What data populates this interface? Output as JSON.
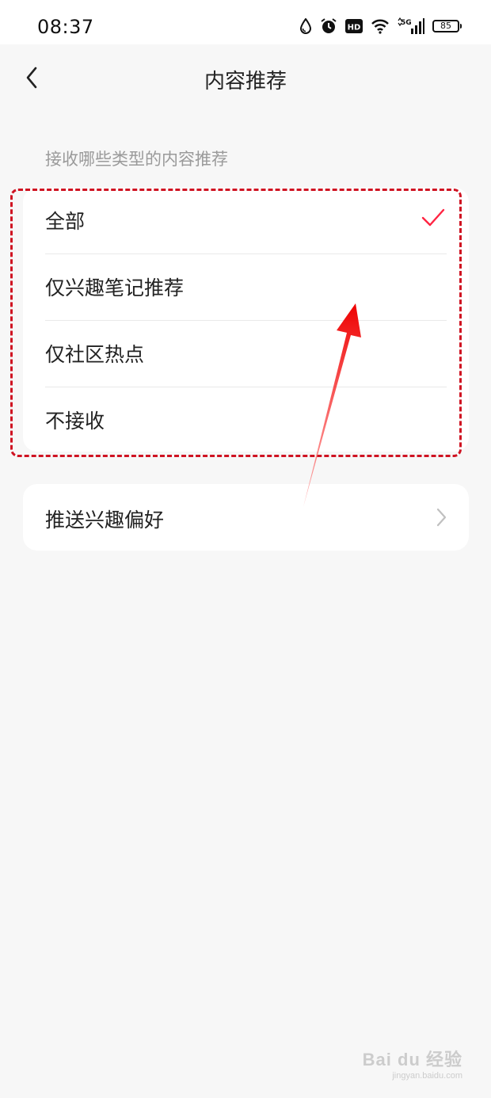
{
  "status_bar": {
    "time": "08:37",
    "icons": [
      "water-drop-icon",
      "alarm-icon",
      "hd-icon",
      "wifi-icon",
      "5g-signal-icon",
      "battery-icon"
    ],
    "hd_label": "HD",
    "network_label": "5G",
    "battery": "85"
  },
  "nav": {
    "title": "内容推荐",
    "back_icon": "chevron-left-icon"
  },
  "section": {
    "label": "接收哪些类型的内容推荐"
  },
  "options": [
    {
      "label": "全部",
      "selected": true
    },
    {
      "label": "仅兴趣笔记推荐",
      "selected": false
    },
    {
      "label": "仅社区热点",
      "selected": false
    },
    {
      "label": "不接收",
      "selected": false
    }
  ],
  "preference": {
    "label": "推送兴趣偏好",
    "icon": "chevron-right-icon"
  },
  "colors": {
    "accent": "#ff2442",
    "annotation": "#cf1322",
    "background": "#f7f7f7",
    "card": "#ffffff"
  },
  "watermark": {
    "main": "Bai du 经验",
    "sub": "jingyan.baidu.com"
  }
}
